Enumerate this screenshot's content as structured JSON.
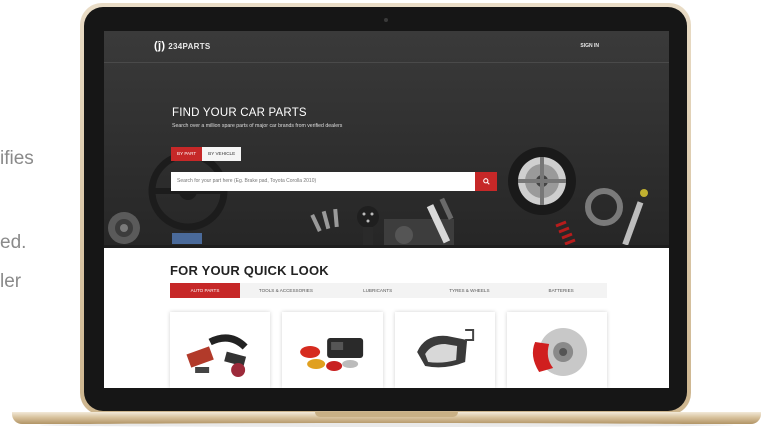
{
  "side_text": {
    "line1": "ifies",
    "line2": "ed.",
    "line3": "ler"
  },
  "site": {
    "logo_text": "234PARTS",
    "logo_mark": "(ĵ)",
    "signin": "SIGN IN"
  },
  "hero": {
    "title": "FIND YOUR CAR PARTS",
    "subtitle": "Search over a million spare parts of major car brands from verified dealers",
    "tabs": [
      {
        "label": "BY PART",
        "active": true
      },
      {
        "label": "BY VEHICLE",
        "active": false
      }
    ],
    "search_placeholder": "Search for your part here (Eg. Brake pad, Toyota Corolla 2010)"
  },
  "quick_look": {
    "title": "FOR YOUR QUICK LOOK",
    "categories": [
      {
        "label": "AUTO PARTS",
        "active": true
      },
      {
        "label": "TOOLS & ACCESSORIES",
        "active": false
      },
      {
        "label": "LUBRICANTS",
        "active": false
      },
      {
        "label": "TYRES & WHEELS",
        "active": false
      },
      {
        "label": "BATTERIES",
        "active": false
      }
    ],
    "cards": [
      {
        "icon": "air-intake-parts-icon"
      },
      {
        "icon": "lights-parts-icon"
      },
      {
        "icon": "body-panel-parts-icon"
      },
      {
        "icon": "brake-disc-icon"
      }
    ]
  },
  "colors": {
    "accent": "#c62828",
    "hero_bg": "#2f2f2f",
    "laptop_gold": "#d8c29d"
  }
}
